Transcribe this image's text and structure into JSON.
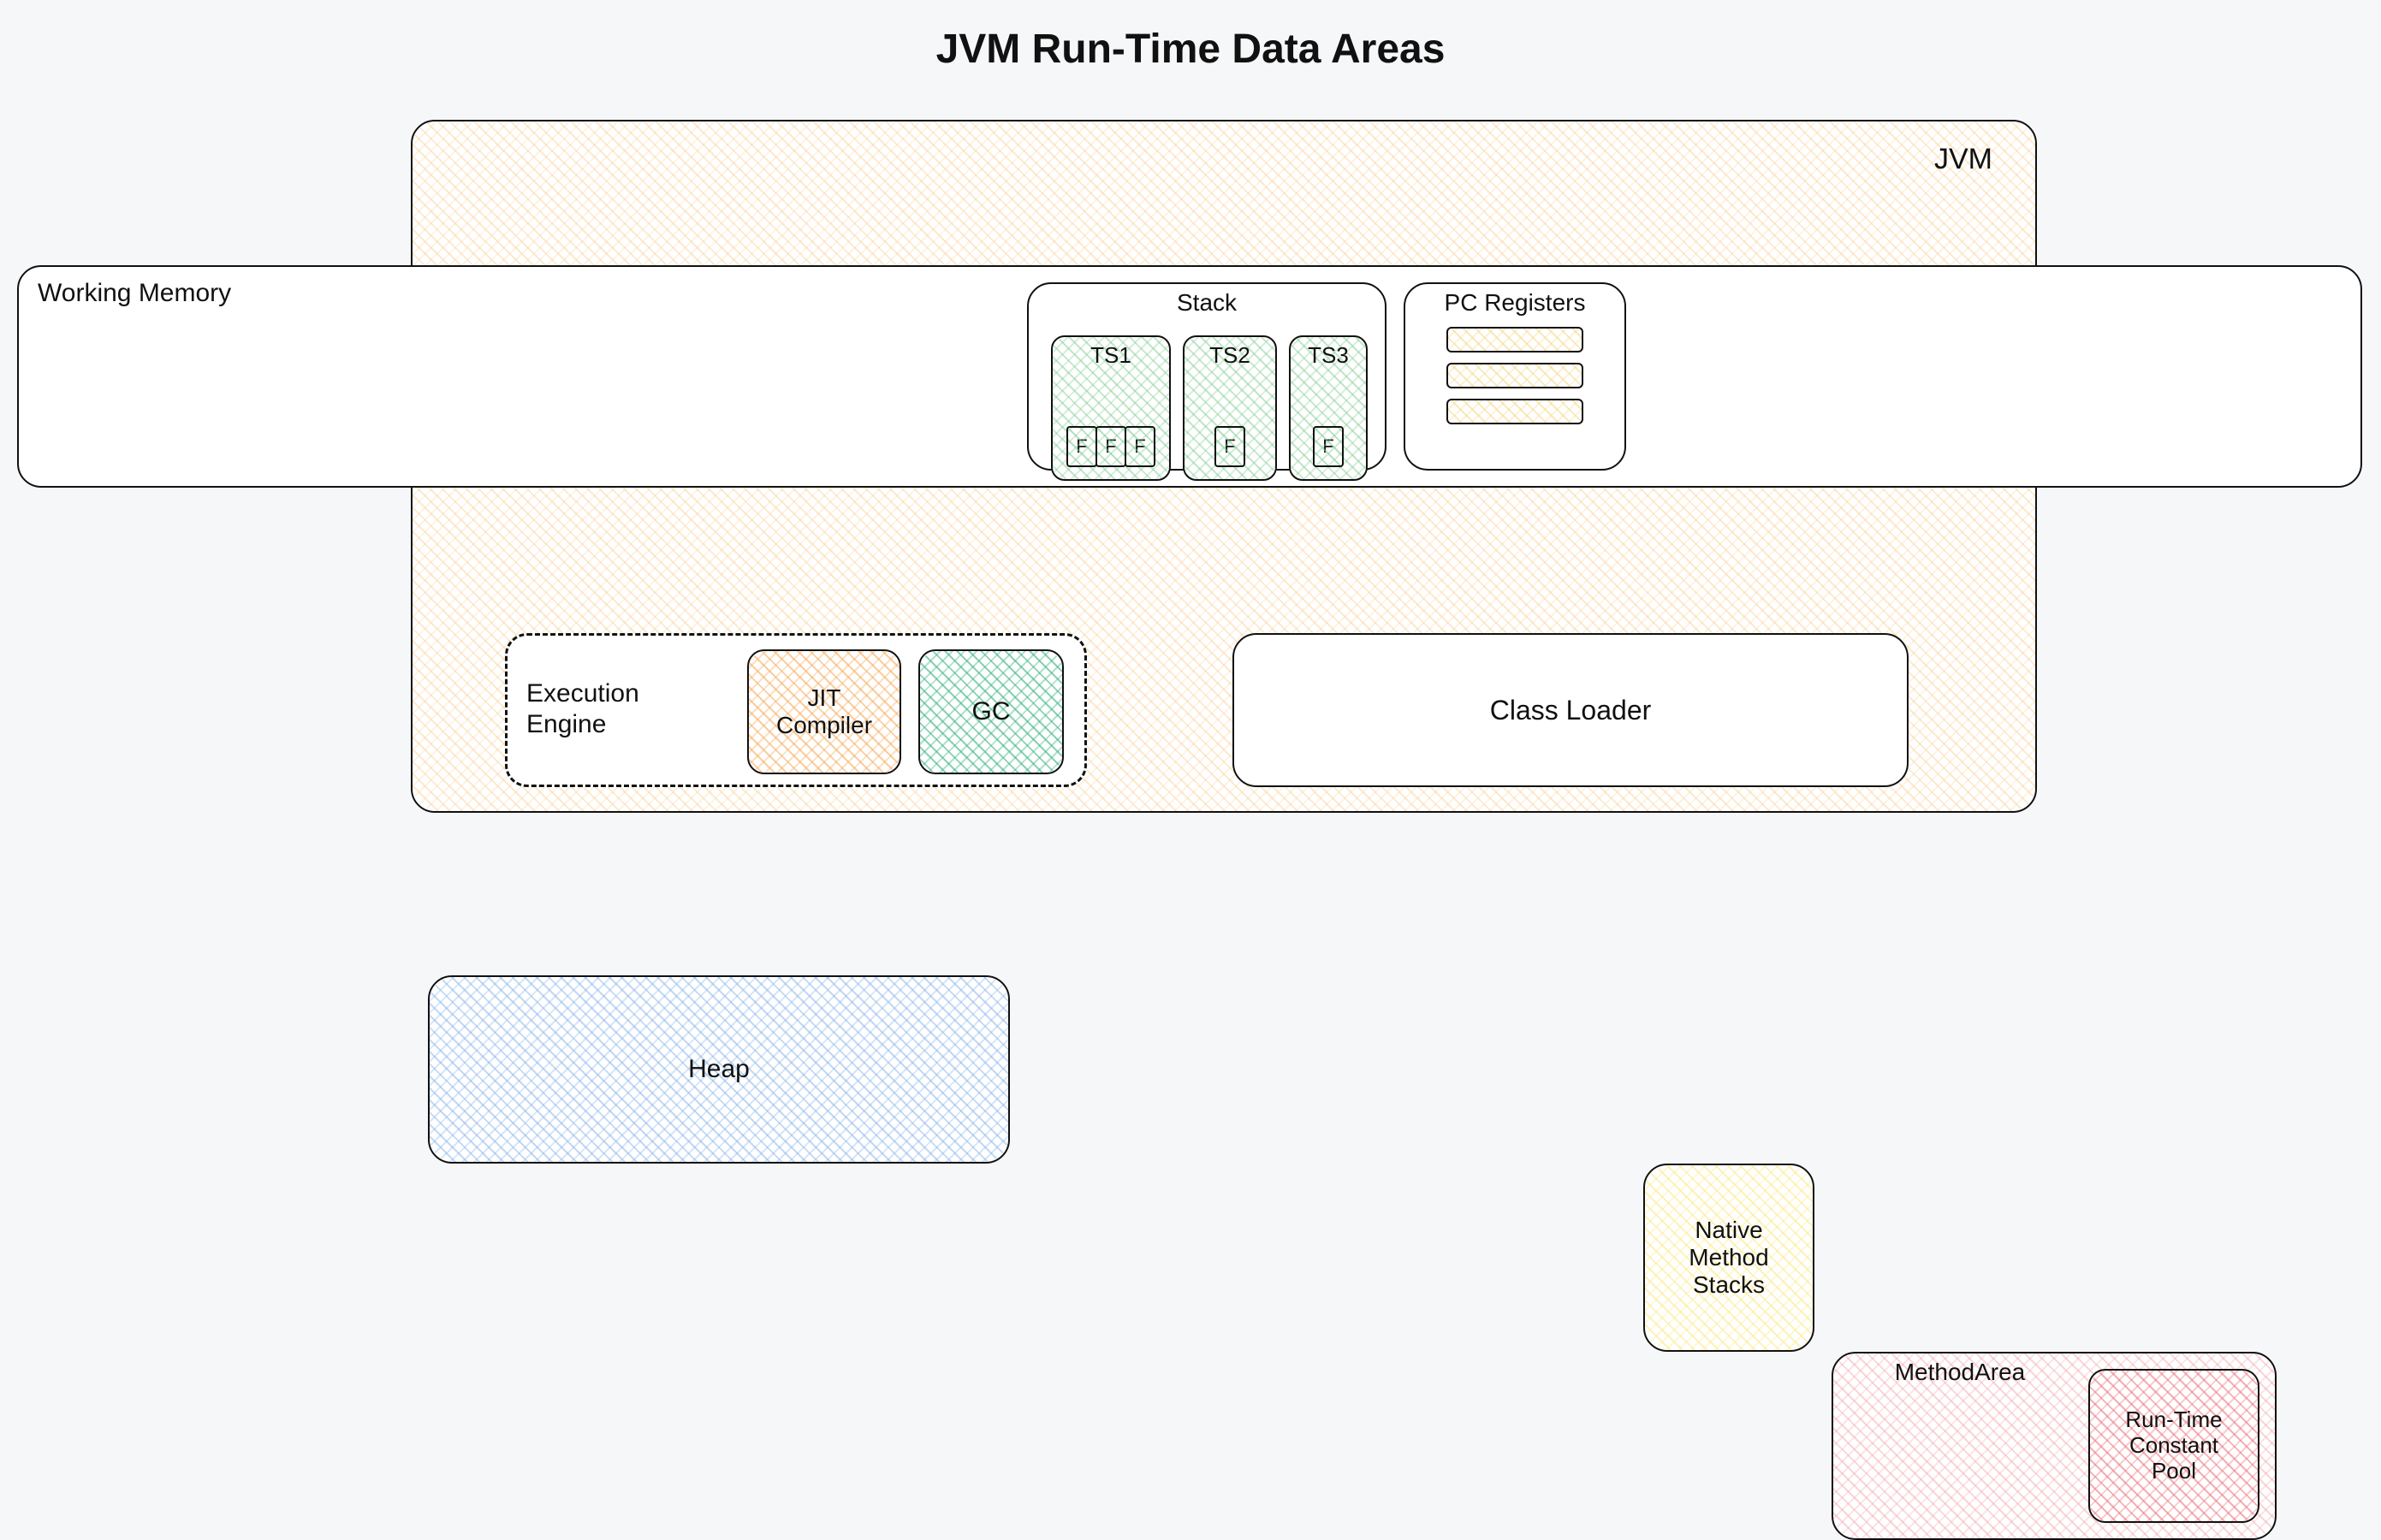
{
  "title": "JVM Run-Time Data Areas",
  "jvm": {
    "label": "JVM"
  },
  "working_memory": {
    "label": "Working Memory"
  },
  "heap": {
    "label": "Heap"
  },
  "stack": {
    "label": "Stack",
    "threads": [
      {
        "label": "TS1",
        "frames": [
          "F",
          "F",
          "F"
        ]
      },
      {
        "label": "TS2",
        "frames": [
          "F"
        ]
      },
      {
        "label": "TS3",
        "frames": [
          "F"
        ]
      }
    ]
  },
  "pc_registers": {
    "label": "PC Registers",
    "rows": 3
  },
  "native_method_stacks": {
    "label": "Native\nMethod\nStacks"
  },
  "method_area": {
    "label": "MethodArea",
    "runtime_constant_pool": "Run-Time\nConstant\nPool"
  },
  "execution_engine": {
    "label": "Execution\nEngine",
    "jit": "JIT\nCompiler",
    "gc": "GC"
  },
  "class_loader": {
    "label": "Class Loader"
  }
}
